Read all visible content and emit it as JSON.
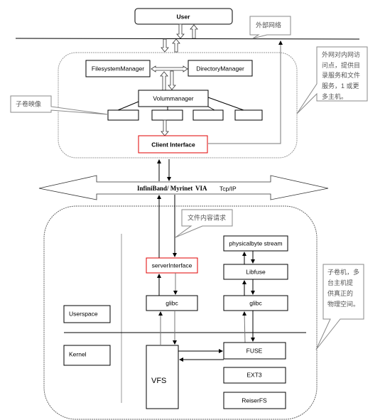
{
  "nodes": {
    "user": "User",
    "filesystem_manager": "FilesystemManager",
    "directory_manager": "DirectoryManager",
    "volum_manager": "Volummanager",
    "client_interface": "Client Interface",
    "server_interface": "serverInterface",
    "glibc_left": "glibc",
    "physicalbyte_stream": "physicalbyte stream",
    "libfuse": "Libfuse",
    "glibc_right": "glibc",
    "userspace": "Userspace",
    "kernel": "Kernel",
    "vfs": "VFS",
    "fuse": "FUSE",
    "ext3": "EXT3",
    "reiserfs": "ReiserFS"
  },
  "network": {
    "infiniband": "InfiniBand/ Myrinet",
    "via": "VIA",
    "tcpip": "Tcp/IP"
  },
  "callouts": {
    "external_network": "外部网络",
    "subvolume_image": "子卷映像",
    "access_point": [
      "外网对内网访",
      "问点，提供目",
      "录服务和文件",
      "服务，1 或更",
      "多主机。"
    ],
    "file_content_request": "文件内容请求",
    "subvolume_machine": [
      "子卷机，多",
      "台主机提",
      "供真正的",
      "物理空间。"
    ]
  },
  "colors": {
    "highlight_border": "#e00000"
  }
}
